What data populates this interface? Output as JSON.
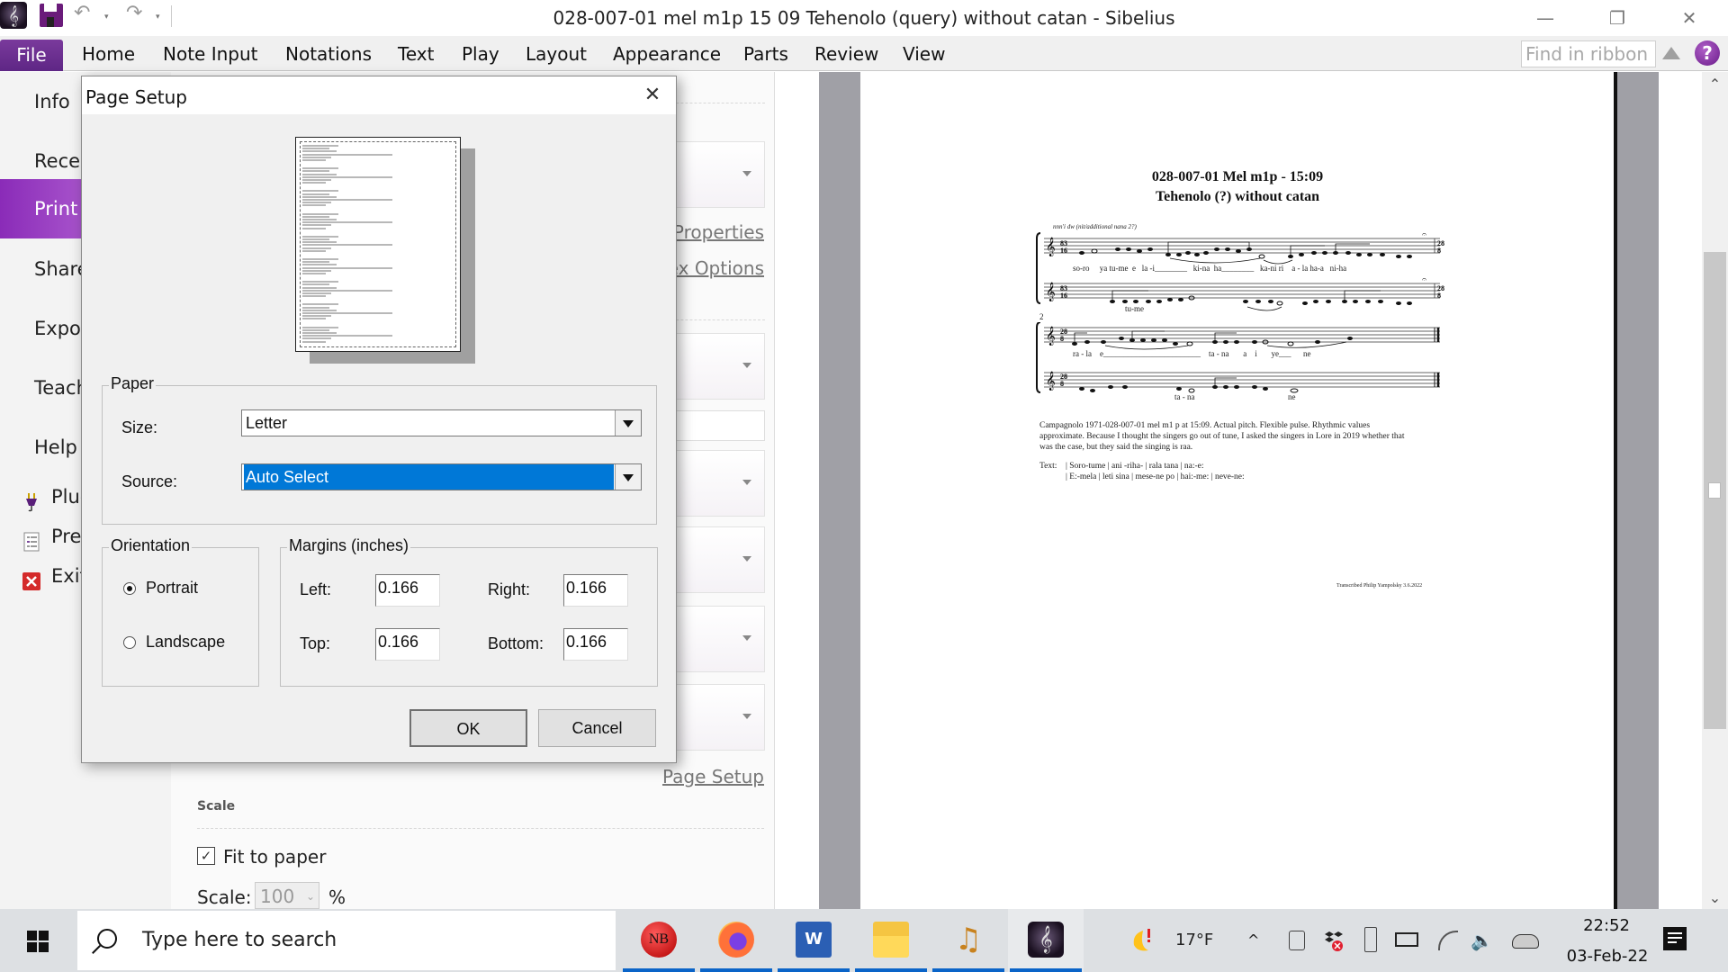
{
  "window": {
    "title": "028-007-01 mel m1p 15 09 Tehenolo (query) without catan - Sibelius",
    "minimize_glyph": "—",
    "restore_glyph": "❐",
    "close_glyph": "✕"
  },
  "quick_access": {
    "app_icon": "sibelius-icon",
    "undo_glyph": "↶",
    "redo_glyph": "↷",
    "caret": "▾"
  },
  "ribbon": {
    "file_tab": "File",
    "tabs": [
      "Home",
      "Note Input",
      "Notations",
      "Text",
      "Play",
      "Layout",
      "Appearance",
      "Parts",
      "Review",
      "View"
    ],
    "find_placeholder": "Find in ribbon",
    "help_glyph": "?"
  },
  "backstage_nav": {
    "items": [
      "Info",
      "Recent",
      "Print",
      "Share",
      "Export",
      "Teaching",
      "Help"
    ],
    "visible_labels": [
      "Info",
      "Recer",
      "Print",
      "Share",
      "Expor",
      "Teach",
      "Help"
    ],
    "active": "Print",
    "small_items": [
      {
        "label": "Plug",
        "icon": "plug-icon"
      },
      {
        "label": "Pref",
        "icon": "preferences-icon"
      },
      {
        "label": "Exit",
        "icon": "exit-icon"
      }
    ]
  },
  "print_panel": {
    "links": {
      "properties": "Properties",
      "duplex_options": "ex Options",
      "page_setup": "Page Setup"
    },
    "scale_heading": "Scale",
    "fit_to_paper_label": "Fit to paper",
    "fit_to_paper_checked": true,
    "check_glyph": "✓",
    "scale_label": "Scale:",
    "scale_value": "100",
    "scale_unit": "%",
    "chevron": "⌄"
  },
  "dialog": {
    "title": "Page Setup",
    "close_glyph": "✕",
    "paper_group": "Paper",
    "size_label": "Size:",
    "size_value": "Letter",
    "source_label": "Source:",
    "source_value": "Auto Select",
    "orientation_group": "Orientation",
    "portrait_label": "Portrait",
    "landscape_label": "Landscape",
    "orientation_selected": "Portrait",
    "margins_group": "Margins (inches)",
    "left_label": "Left:",
    "left_value": "0.166",
    "right_label": "Right:",
    "right_value": "0.166",
    "top_label": "Top:",
    "top_value": "0.166",
    "bottom_label": "Bottom:",
    "bottom_value": "0.166",
    "ok_label": "OK",
    "cancel_label": "Cancel"
  },
  "score_preview": {
    "title_line1": "028-007-01 Mel m1p - 15:09",
    "title_line2": "Tehenolo (?) without catan",
    "tempo_text": "nnn'i dw (nit/additional nana 2?)",
    "time_sig_1": "83/16",
    "time_sig_2": "28/8",
    "system2_number": "2",
    "lyrics_s1_top": "so-ro     ya tu-me  e   la -i________   ki-na  ha________   ka-ni ri    a - la ha-a   ni-ha",
    "lyrics_s1_bottom": "tu-me",
    "lyrics_s2_top": "ra - la    e________________________    ta - na       a    i       ye___      ne",
    "lyrics_s2_bottom_1": "ta - na",
    "lyrics_s2_bottom_2": "ne",
    "notes_line1": "Campagnolo 1971-028-007-01 mel m1 p at 15:09. Actual pitch. Flexible pulse. Rhythmic values",
    "notes_line2": "approximate. Because I thought the singers go out of tune, I asked the singers in Lore in 2019 whether that",
    "notes_line3": "was the case, but they said the singing is raa.",
    "text_label": "Text:",
    "text_line1": "| Soro-tume | ani -riha- | rala tana | na:-e:",
    "text_line2": "| E:-mela | leti sina | mese-ne po | hai:-me: | neve-ne:",
    "footer": "Transcribed Philip Yampolsky 3.6.2022"
  },
  "taskbar": {
    "search_placeholder": "Type here to search",
    "apps": [
      {
        "name": "nb-app",
        "label": "NB"
      },
      {
        "name": "firefox",
        "label": ""
      },
      {
        "name": "word",
        "label": "W"
      },
      {
        "name": "file-explorer",
        "label": ""
      },
      {
        "name": "music-app",
        "label": "♫"
      },
      {
        "name": "sibelius",
        "label": "𝄞"
      }
    ],
    "weather": "17°F",
    "tray_chevron": "^",
    "time": "22:52",
    "date": "03-Feb-22"
  }
}
